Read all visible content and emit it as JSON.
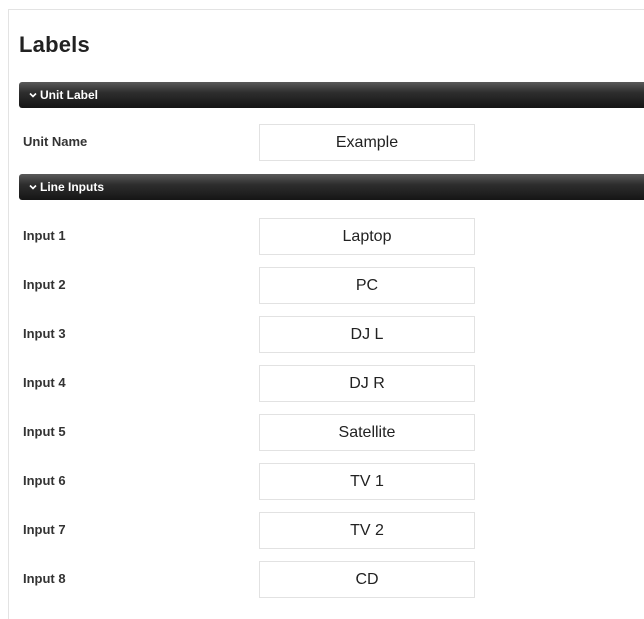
{
  "page": {
    "title": "Labels"
  },
  "unit_label_section": {
    "title": "Unit Label",
    "unit_name_label": "Unit Name",
    "unit_name_value": "Example"
  },
  "line_inputs_section": {
    "title": "Line Inputs",
    "inputs": [
      {
        "label": "Input 1",
        "value": "Laptop"
      },
      {
        "label": "Input 2",
        "value": "PC"
      },
      {
        "label": "Input 3",
        "value": "DJ L"
      },
      {
        "label": "Input 4",
        "value": "DJ R"
      },
      {
        "label": "Input 5",
        "value": "Satellite"
      },
      {
        "label": "Input 6",
        "value": "TV 1"
      },
      {
        "label": "Input 7",
        "value": "TV 2"
      },
      {
        "label": "Input 8",
        "value": "CD"
      }
    ]
  },
  "colors": {
    "header_bg": "#1c1c1c",
    "header_text": "#ffffff",
    "field_border": "#e2e2e2"
  }
}
